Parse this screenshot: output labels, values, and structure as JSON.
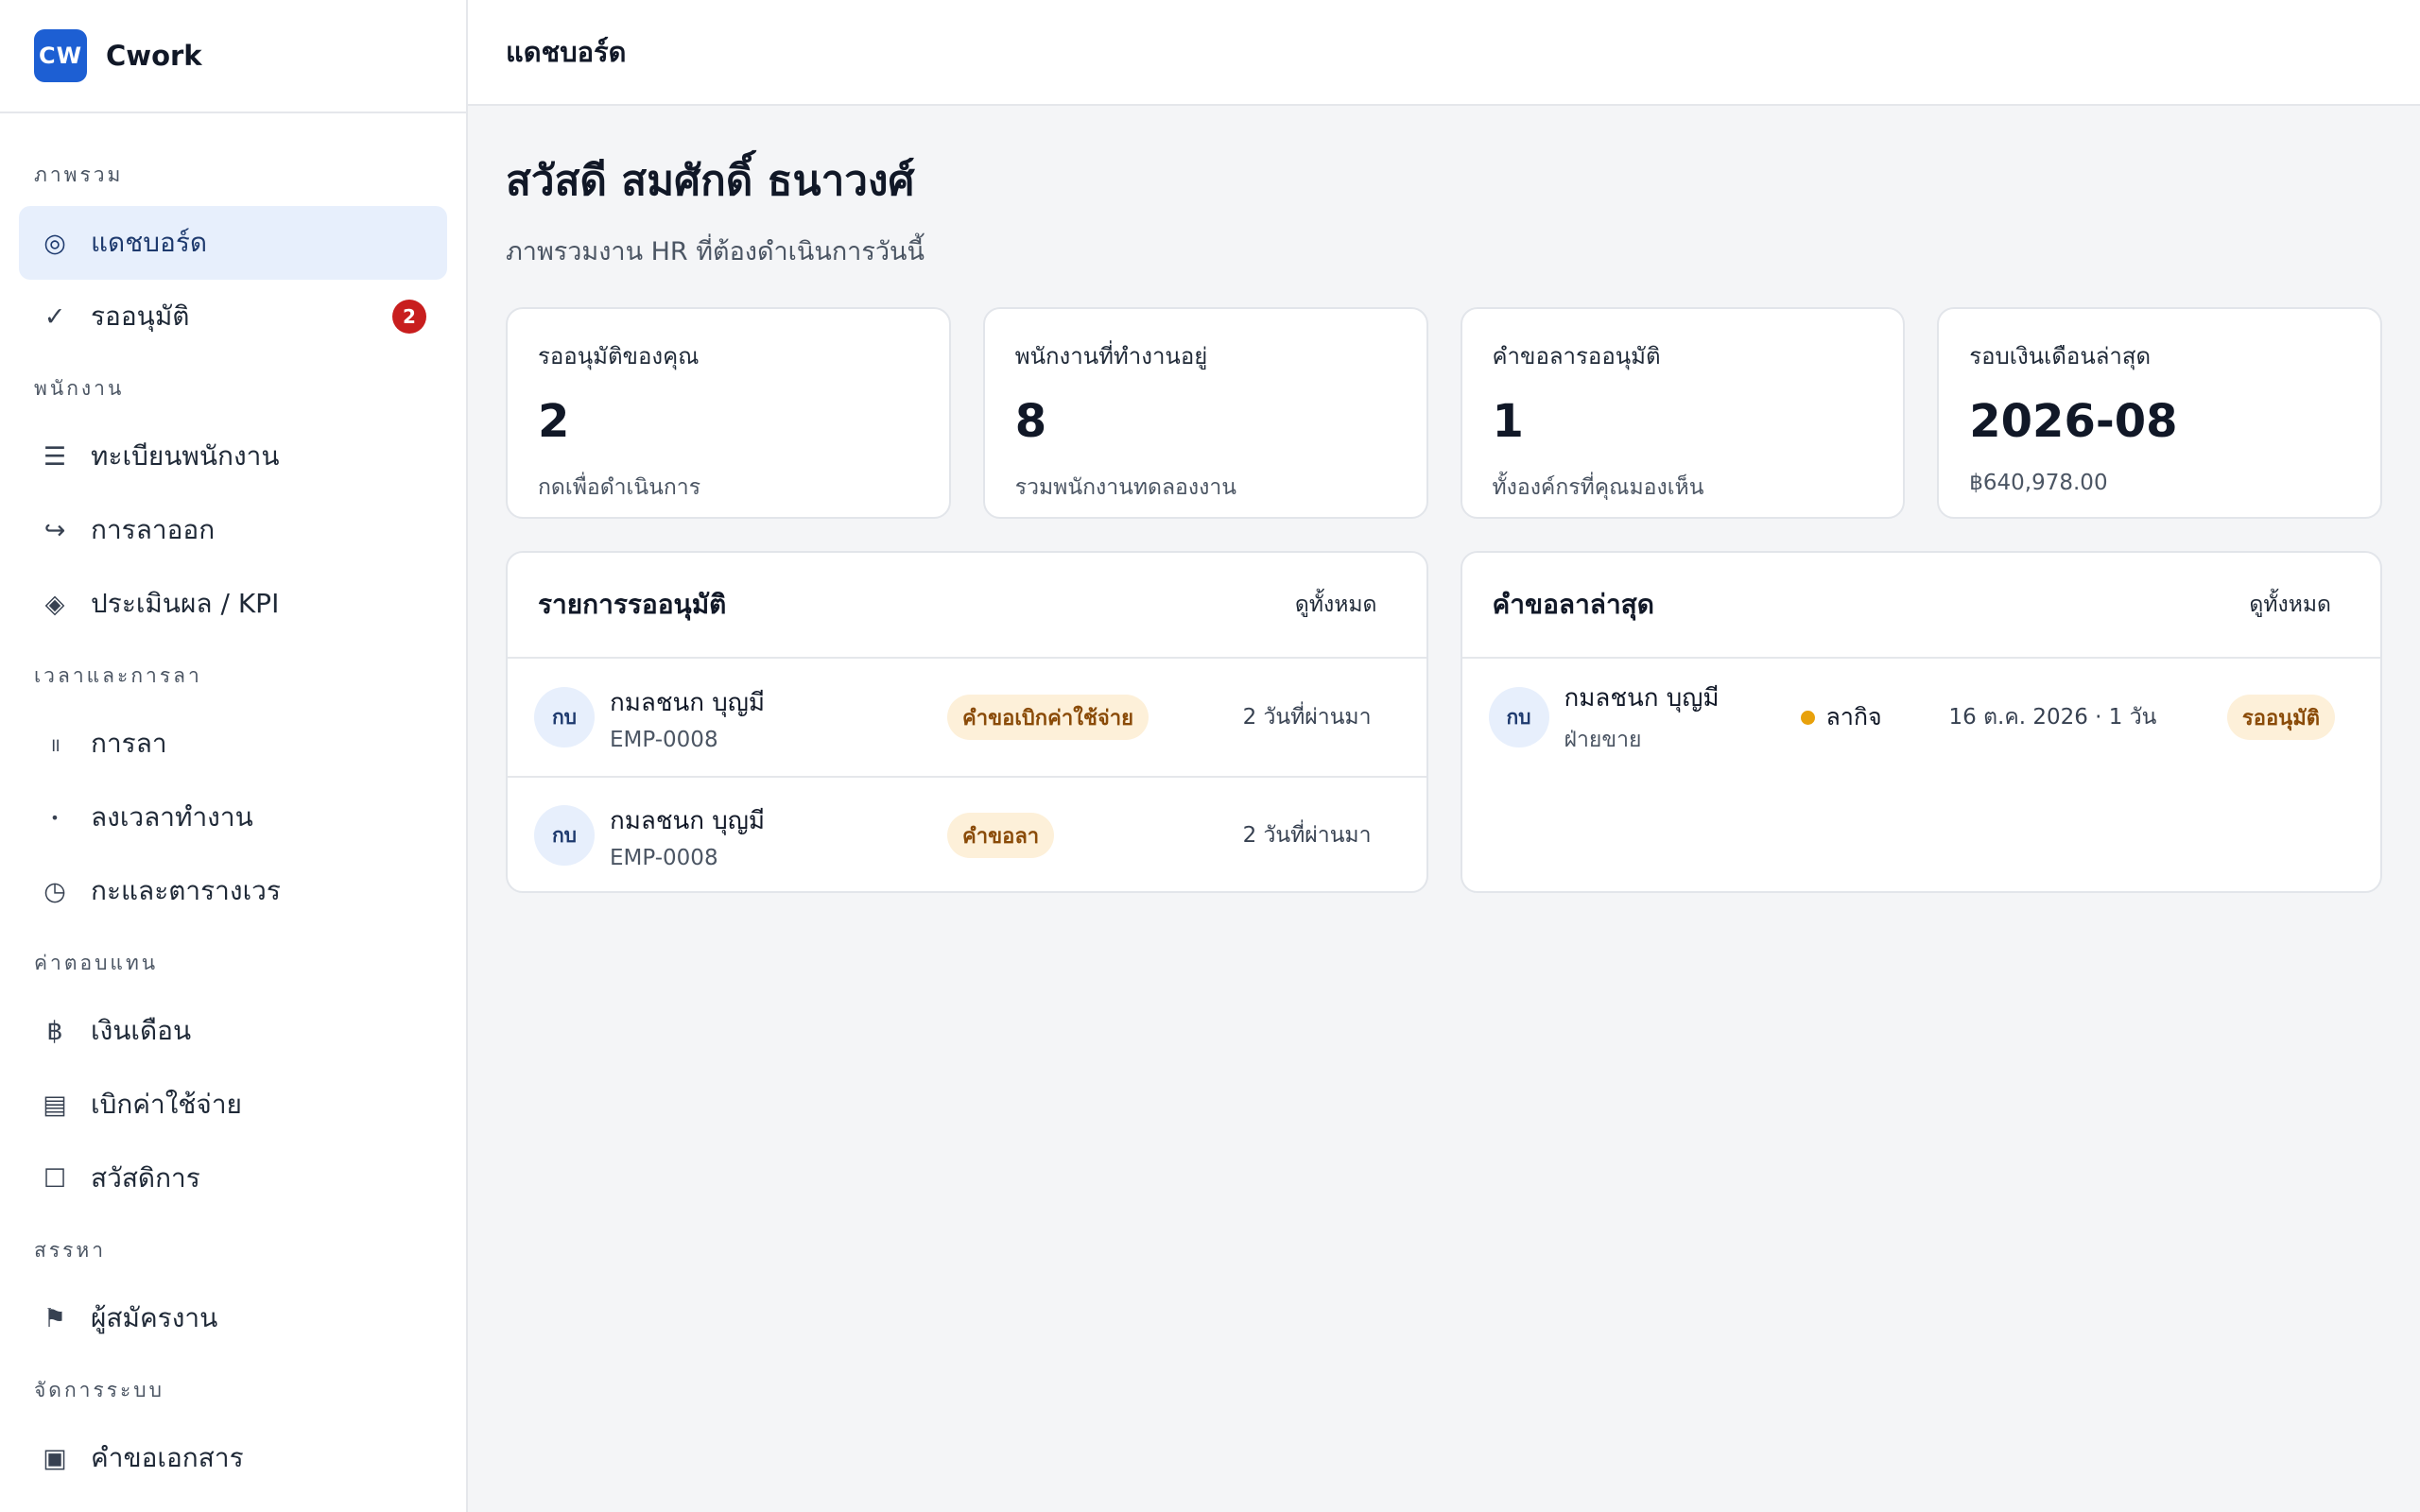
{
  "brand": {
    "logo": "CW",
    "name": "Cwork",
    "accent": "#1d5fd3"
  },
  "sidebar": {
    "sections": [
      {
        "heading": "ภาพรวม",
        "items": [
          {
            "label": "แดชบอร์ด",
            "icon": "target-icon",
            "active": true
          },
          {
            "label": "รออนุมัติ",
            "icon": "check-icon",
            "badge": "2"
          }
        ]
      },
      {
        "heading": "พนักงาน",
        "items": [
          {
            "label": "ทะเบียนพนักงาน",
            "icon": "list-icon"
          },
          {
            "label": "การลาออก",
            "icon": "exit-arrow-icon"
          },
          {
            "label": "ประเมินผล / KPI",
            "icon": "diamond-icon"
          }
        ]
      },
      {
        "heading": "เวลาและการลา",
        "items": [
          {
            "label": "การลา",
            "icon": "pause-icon"
          },
          {
            "label": "ลงเวลาทำงาน",
            "icon": "dot-icon"
          },
          {
            "label": "กะและตารางเวร",
            "icon": "clock-icon"
          }
        ]
      },
      {
        "heading": "ค่าตอบแทน",
        "items": [
          {
            "label": "เงินเดือน",
            "icon": "baht-icon"
          },
          {
            "label": "เบิกค่าใช้จ่าย",
            "icon": "receipt-icon"
          },
          {
            "label": "สวัสดิการ",
            "icon": "box-icon"
          }
        ]
      },
      {
        "heading": "สรรหา",
        "items": [
          {
            "label": "ผู้สมัครงาน",
            "icon": "flag-icon"
          }
        ]
      },
      {
        "heading": "จัดการระบบ",
        "items": [
          {
            "label": "คำขอเอกสาร",
            "icon": "document-icon"
          }
        ]
      }
    ]
  },
  "topbar": {
    "title": "แดชบอร์ด"
  },
  "main": {
    "greeting": "สวัสดี สมศักดิ์ ธนาวงศ์",
    "subtitle": "ภาพรวมงาน HR ที่ต้องดำเนินการวันนี้",
    "stats": [
      {
        "label": "รออนุมัติของคุณ",
        "value": "2",
        "sub": "กดเพื่อดำเนินการ"
      },
      {
        "label": "พนักงานที่ทำงานอยู่",
        "value": "8",
        "sub": "รวมพนักงานทดลองงาน"
      },
      {
        "label": "คำขอลารออนุมัติ",
        "value": "1",
        "sub": "ทั้งองค์กรที่คุณมองเห็น"
      },
      {
        "label": "รอบเงินเดือนล่าสุด",
        "value": "2026-08",
        "sub": "฿640,978.00"
      }
    ],
    "approvals": {
      "title": "รายการรออนุมัติ",
      "link": "ดูทั้งหมด",
      "rows": [
        {
          "avatar": "กบ",
          "name": "กมลชนก บุญมี",
          "sub": "EMP-0008",
          "tag": "คำขอเบิกค่าใช้จ่าย",
          "when": "2 วันที่ผ่านมา"
        },
        {
          "avatar": "กบ",
          "name": "กมลชนก บุญมี",
          "sub": "EMP-0008",
          "tag": "คำขอลา",
          "when": "2 วันที่ผ่านมา"
        }
      ]
    },
    "leaves": {
      "title": "คำขอลาล่าสุด",
      "link": "ดูทั้งหมด",
      "rows": [
        {
          "avatar": "กบ",
          "name": "กมลชนก บุญมี",
          "sub": "ฝ่ายขาย",
          "type": "ลากิจ",
          "date": "16 ต.ค. 2026 · 1 วัน",
          "status": "รออนุมัติ"
        }
      ]
    }
  }
}
